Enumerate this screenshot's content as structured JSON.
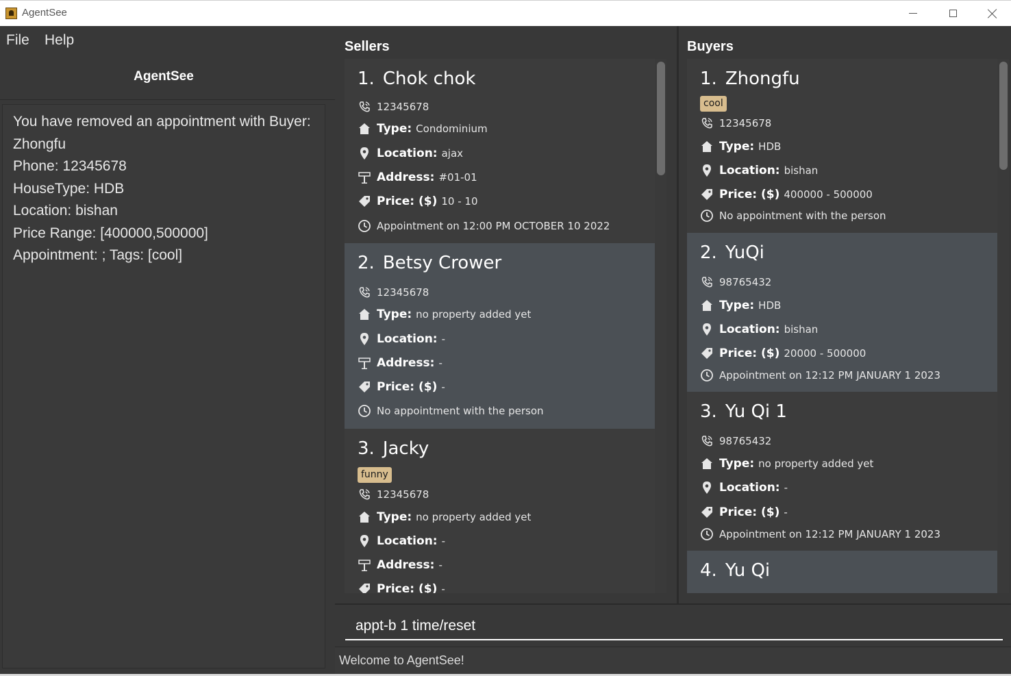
{
  "window": {
    "title": "AgentSee"
  },
  "menu": {
    "file": "File",
    "help": "Help"
  },
  "app_heading": "AgentSee",
  "result_lines": [
    "You have removed an appointment with Buyer:",
    "Zhongfu",
    "Phone: 12345678",
    "HouseType: HDB",
    "Location: bishan",
    "Price Range: [400000,500000]",
    "Appointment: ; Tags: [cool]"
  ],
  "labels": {
    "type": "Type:",
    "location": "Location:",
    "address": "Address:",
    "price": "Price: ($)"
  },
  "sellers": {
    "title": "Sellers",
    "items": [
      {
        "index": "1.",
        "name": "Chok chok",
        "phone": "12345678",
        "type": "Condominium",
        "location": "ajax",
        "address": "#01-01",
        "price": "10  -  10",
        "appointment": "Appointment on 12:00 PM OCTOBER 10 2022"
      },
      {
        "index": "2.",
        "name": "Betsy Crower",
        "phone": "12345678",
        "type": "no property added yet",
        "location": "-",
        "address": "-",
        "price": "-",
        "appointment": "No appointment with the person"
      },
      {
        "index": "3.",
        "name": "Jacky",
        "tag": "funny",
        "phone": "12345678",
        "type": "no property added yet",
        "location": "-",
        "address": "-",
        "price": "-"
      }
    ]
  },
  "buyers": {
    "title": "Buyers",
    "items": [
      {
        "index": "1.",
        "name": "Zhongfu",
        "tag": "cool",
        "phone": "12345678",
        "type": "HDB",
        "location": "bishan",
        "price": "400000  -  500000",
        "appointment": "No appointment with the person"
      },
      {
        "index": "2.",
        "name": "YuQi",
        "phone": "98765432",
        "type": "HDB",
        "location": "bishan",
        "price": "20000  -  500000",
        "appointment": "Appointment on 12:12 PM JANUARY 1 2023"
      },
      {
        "index": "3.",
        "name": "Yu Qi 1",
        "phone": "98765432",
        "type": "no property added yet",
        "location": "-",
        "price": "-",
        "appointment": "Appointment on 12:12 PM JANUARY 1 2023"
      },
      {
        "index": "4.",
        "name": "Yu Qi"
      }
    ]
  },
  "command": {
    "value": "appt-b 1 time/reset"
  },
  "status": "Welcome to AgentSee!",
  "colors": {
    "tag_bg": "#d8bd8e",
    "card_selected": "#4b5055",
    "background": "#383838"
  },
  "icons": [
    "phone-icon",
    "house-icon",
    "location-pin-icon",
    "signpost-icon",
    "price-tag-icon",
    "clock-icon"
  ]
}
